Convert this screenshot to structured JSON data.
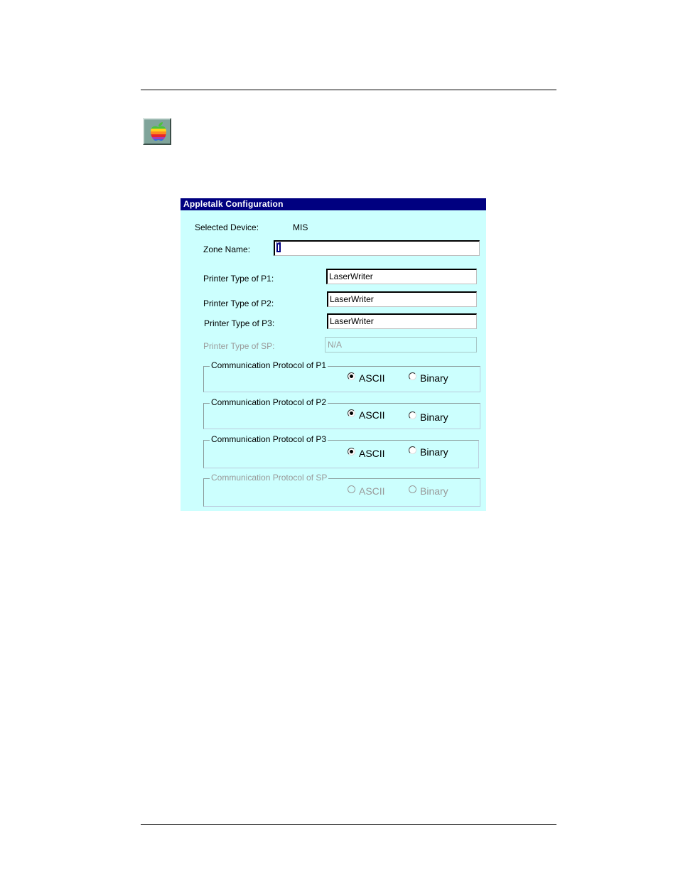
{
  "dialog": {
    "title": "Appletalk Configuration",
    "selected_device_label": "Selected Device:",
    "selected_device_value": "MIS",
    "zone_name_label": "Zone Name:",
    "zone_name_value": "*",
    "printers": [
      {
        "label": "Printer Type of P1:",
        "value": "LaserWriter",
        "enabled": true
      },
      {
        "label": "Printer Type of P2:",
        "value": "LaserWriter",
        "enabled": true
      },
      {
        "label": "Printer Type of P3:",
        "value": "LaserWriter",
        "enabled": true
      },
      {
        "label": "Printer Type of SP:",
        "value": "N/A",
        "enabled": false
      }
    ],
    "protocols": [
      {
        "title": "Communication Protocol of P1",
        "ascii": "ASCII",
        "binary": "Binary",
        "selected": "ASCII",
        "enabled": true
      },
      {
        "title": "Communication Protocol of P2",
        "ascii": "ASCII",
        "binary": "Binary",
        "selected": "ASCII",
        "enabled": true
      },
      {
        "title": "Communication Protocol of P3",
        "ascii": "ASCII",
        "binary": "Binary",
        "selected": "ASCII",
        "enabled": true
      },
      {
        "title": "Communication Protocol of SP",
        "ascii": "ASCII",
        "binary": "Binary",
        "selected": "",
        "enabled": false
      }
    ]
  },
  "icons": {
    "appletalk": "apple-logo-icon"
  },
  "colors": {
    "title_bar": "#000080",
    "dialog_background": "#ccfffe",
    "disabled_text": "#9a9a9a"
  }
}
